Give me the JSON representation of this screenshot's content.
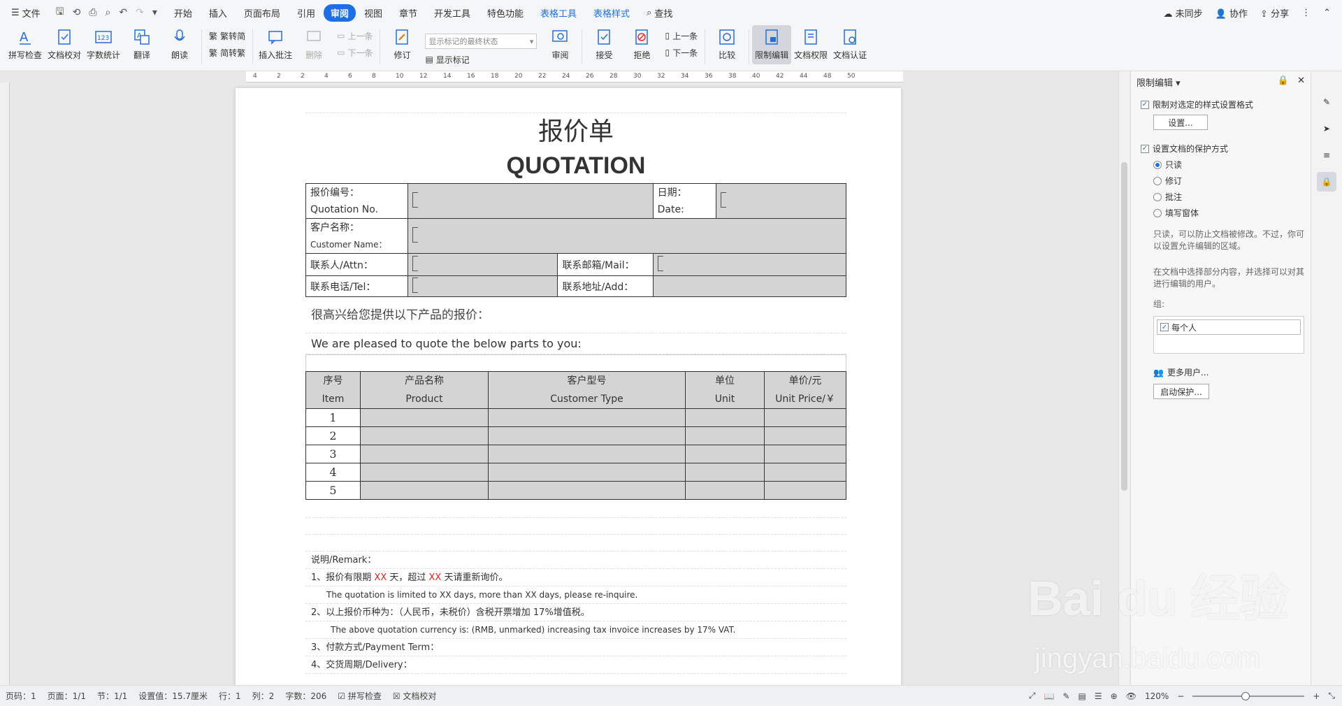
{
  "menu": {
    "file": "文件",
    "tabs": [
      "开始",
      "插入",
      "页面布局",
      "引用",
      "审阅",
      "视图",
      "章节",
      "开发工具",
      "特色功能",
      "表格工具",
      "表格样式"
    ],
    "active_tab": "审阅",
    "search": "查找",
    "sync": "未同步",
    "collab": "协作",
    "share": "分享"
  },
  "ribbon": {
    "spell": "拼写检查",
    "proof": "文档校对",
    "wordcount": "字数统计",
    "translate": "翻译",
    "read": "朗读",
    "trad_to_simp": "繁转简",
    "simp_to_trad": "简转繁",
    "insert_comment": "插入批注",
    "delete": "删除",
    "prev_comment": "上一条",
    "next_comment": "下一条",
    "revise": "修订",
    "show_markup_select": "显示标记的最终状态",
    "show_markup": "显示标记",
    "review": "审阅",
    "accept": "接受",
    "reject": "拒绝",
    "prev": "上一条",
    "next": "下一条",
    "compare": "比较",
    "restrict_edit": "限制编辑",
    "doc_permission": "文档权限",
    "doc_cert": "文档认证"
  },
  "ruler": [
    "4",
    "2",
    "2",
    "4",
    "6",
    "8",
    "10",
    "12",
    "14",
    "16",
    "18",
    "20",
    "22",
    "24",
    "26",
    "28",
    "30",
    "32",
    "34",
    "36",
    "38",
    "40",
    "42",
    "44",
    "48",
    "50"
  ],
  "doc": {
    "title_cn": "报价单",
    "title_en": "QUOTATION",
    "info": {
      "quote_no_cn": "报价编号：",
      "quote_no_en": "Quotation No.",
      "date_cn": "日期：",
      "date_en": "Date:",
      "customer_cn": "客户名称：",
      "customer_en": "Customer Name：",
      "attn": "联系人/Attn：",
      "mail": "联系邮箱/Mail：",
      "tel": "联系电话/Tel：",
      "add": "联系地址/Add："
    },
    "intro_cn": "很高兴给您提供以下产品的报价：",
    "intro_en": "We are pleased to quote the below parts to you:",
    "items_header": [
      {
        "cn": "序号",
        "en": "Item"
      },
      {
        "cn": "产品名称",
        "en": "Product"
      },
      {
        "cn": "客户型号",
        "en": "Customer Type"
      },
      {
        "cn": "单位",
        "en": "Unit"
      },
      {
        "cn": "单价/元",
        "en": "Unit Price/￥"
      }
    ],
    "items": [
      "1",
      "2",
      "3",
      "4",
      "5"
    ],
    "remark_title": "说明/Remark：",
    "r1_a": "1、报价有限期",
    "r1_x1": "XX",
    "r1_b": "天，超过",
    "r1_x2": "XX",
    "r1_c": "天请重新询价。",
    "r1_en": "The quotation is limited to XX days, more than XX days, please re-inquire.",
    "r2": "2、以上报价币种为：（人民币，未税价）含税开票增加 17%增值税。",
    "r2_en": "The above quotation currency is: (RMB, unmarked) increasing tax invoice increases by 17% VAT.",
    "r3": "3、付款方式/Payment Term：",
    "r4": "4、交货周期/Delivery："
  },
  "panel": {
    "title": "限制编辑",
    "opt1": "限制对选定的样式设置格式",
    "settings_btn": "设置...",
    "opt2": "设置文档的保护方式",
    "radios": [
      "只读",
      "修订",
      "批注",
      "填写窗体"
    ],
    "note1": "只读，可以防止文档被修改。不过，你可以设置允许编辑的区域。",
    "note2": "在文档中选择部分内容，并选择可以对其进行编辑的用户。",
    "group_label": "组:",
    "group_item": "每个人",
    "more_users": "更多用户...",
    "start_btn": "启动保护..."
  },
  "status": {
    "page": "页码：1",
    "pages": "页面：1/1",
    "section": "节：1/1",
    "setting": "设置值：15.7厘米",
    "row": "行：1",
    "col": "列：2",
    "words": "字数：206",
    "spell": "拼写检查",
    "proof": "文档校对",
    "zoom": "120%"
  },
  "watermark": {
    "brand": "Bai du 经验",
    "url": "jingyan.baidu.com"
  }
}
